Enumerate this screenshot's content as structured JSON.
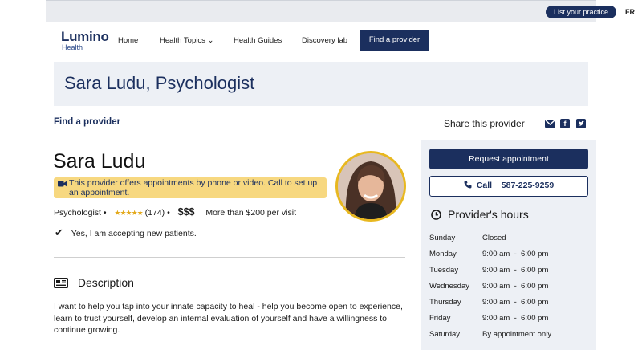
{
  "topbar": {
    "list_practice": "List your practice",
    "lang": "FR"
  },
  "nav": {
    "logo_main": "Lumino",
    "logo_sub": "Health",
    "items": [
      {
        "label": "Home"
      },
      {
        "label": "Health Topics ⌄"
      },
      {
        "label": "Health Guides"
      },
      {
        "label": "Discovery lab"
      }
    ],
    "cta": "Find a provider"
  },
  "hero": {
    "title": "Sara Ludu, Psychologist"
  },
  "breadcrumb": {
    "find": "Find a provider"
  },
  "share": {
    "label": "Share this provider",
    "icons": [
      "mail-icon",
      "facebook-icon",
      "twitter-icon"
    ]
  },
  "provider": {
    "name": "Sara Ludu",
    "notice": "This provider offers appointments by phone or video. Call to set up an appointment.",
    "title": "Psychologist",
    "bullet": "•",
    "stars": "★★★★★",
    "rating": 5,
    "reviews": "(174)",
    "price": "$$$",
    "price_note": "More than $200 per visit",
    "accepting": "Yes, I am accepting new patients."
  },
  "description": {
    "heading": "Description",
    "body": "I want to help you tap into your innate capacity to heal - help you become open to experience, learn to trust yourself, develop an internal evaluation of yourself and have a willingness to continue growing."
  },
  "sidebar": {
    "request": "Request appointment",
    "call_label": "Call",
    "phone": "587-225-9259",
    "hours_title": "Provider's hours",
    "hours": [
      {
        "day": "Sunday",
        "time": "Closed"
      },
      {
        "day": "Monday",
        "time": "9:00 am  -  6:00 pm"
      },
      {
        "day": "Tuesday",
        "time": "9:00 am  -  6:00 pm"
      },
      {
        "day": "Wednesday",
        "time": "9:00 am  -  6:00 pm"
      },
      {
        "day": "Thursday",
        "time": "9:00 am  -  6:00 pm"
      },
      {
        "day": "Friday",
        "time": "9:00 am  -  6:00 pm"
      },
      {
        "day": "Saturday",
        "time": "By appointment only"
      }
    ]
  },
  "colors": {
    "brand": "#1b2f5e",
    "notice": "#f7d880",
    "stars": "#e3a91c",
    "avatar_ring": "#e8b820",
    "panel": "#edf0f5"
  }
}
